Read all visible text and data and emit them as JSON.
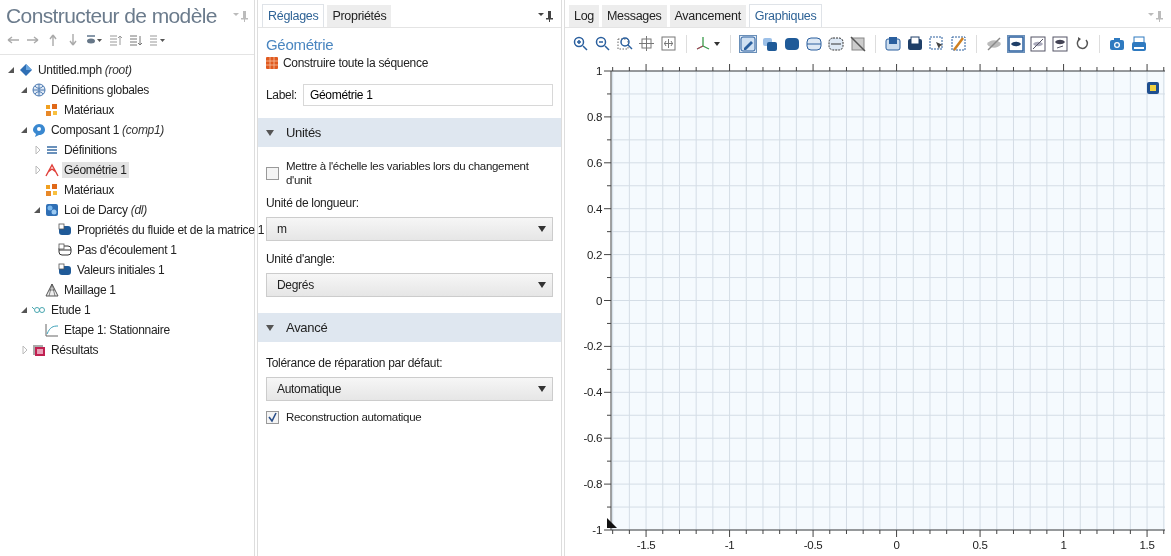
{
  "model_builder": {
    "title": "Constructeur de modèle",
    "toolbar": [
      {
        "kind": "arrow-left"
      },
      {
        "kind": "arrow-right"
      },
      {
        "kind": "arrow-up"
      },
      {
        "kind": "arrow-down"
      },
      {
        "kind": "eye-menu"
      },
      {
        "kind": "sort-up"
      },
      {
        "kind": "sort-down"
      },
      {
        "kind": "list-menu"
      }
    ],
    "tree": [
      {
        "label": "Untitled.mph",
        "suffix": "(root)",
        "kind": "model",
        "expanded": true,
        "selected": false,
        "children": [
          {
            "label": "Définitions globales",
            "kind": "globe",
            "expanded": true,
            "selected": false,
            "children": [
              {
                "label": "Matériaux",
                "kind": "materials",
                "selected": false
              }
            ]
          },
          {
            "label": "Composant 1",
            "suffix": "(comp1)",
            "kind": "component",
            "expanded": true,
            "selected": false,
            "children": [
              {
                "label": "Définitions",
                "kind": "list",
                "expanded": false,
                "selected": false
              },
              {
                "label": "Géométrie 1",
                "kind": "geometry",
                "expanded": false,
                "selected": true
              },
              {
                "label": "Matériaux",
                "kind": "materials",
                "selected": false
              },
              {
                "label": "Loi de Darcy",
                "suffix": "(dl)",
                "kind": "physics",
                "expanded": true,
                "selected": false,
                "children": [
                  {
                    "label": "Propriétés du fluide et de la matrice 1",
                    "kind": "domain",
                    "selected": false
                  },
                  {
                    "label": "Pas d'écoulement 1",
                    "kind": "boundary",
                    "selected": false
                  },
                  {
                    "label": "Valeurs initiales 1",
                    "kind": "domain",
                    "selected": false
                  }
                ]
              },
              {
                "label": "Maillage 1",
                "kind": "mesh",
                "selected": false
              }
            ]
          },
          {
            "label": "Etude 1",
            "kind": "study",
            "expanded": true,
            "selected": false,
            "children": [
              {
                "label": "Etape 1: Stationnaire",
                "kind": "step",
                "selected": false
              }
            ]
          },
          {
            "label": "Résultats",
            "kind": "results",
            "expanded": false,
            "selected": false
          }
        ]
      }
    ]
  },
  "settings": {
    "tabs": [
      {
        "label": "Réglages",
        "selected": true
      },
      {
        "label": "Propriétés",
        "selected": false
      }
    ],
    "heading": "Géométrie",
    "build_button": "Construire toute la séquence",
    "label_field": {
      "label": "Label:",
      "value": "Géométrie 1"
    },
    "sections": [
      {
        "title": "Unités",
        "expanded": true,
        "items": [
          {
            "kind": "checkbox",
            "label": "Mettre à l'échelle les variables lors du changement d'unit",
            "checked": false
          },
          {
            "kind": "select",
            "label": "Unité de longueur:",
            "value": "m"
          },
          {
            "kind": "select",
            "label": "Unité d'angle:",
            "value": "Degrés"
          }
        ]
      },
      {
        "title": "Avancé",
        "expanded": true,
        "items": [
          {
            "kind": "select",
            "label": "Tolérance de réparation par défaut:",
            "value": "Automatique"
          },
          {
            "kind": "checkbox",
            "label": "Reconstruction automatique",
            "checked": true
          }
        ]
      }
    ]
  },
  "graphics_panel": {
    "tabs": [
      {
        "label": "Log",
        "selected": false
      },
      {
        "label": "Messages",
        "selected": false
      },
      {
        "label": "Avancement",
        "selected": false
      },
      {
        "label": "Graphiques",
        "selected": true
      }
    ],
    "toolbar": [
      {
        "kind": "zoom-in",
        "selected": false
      },
      {
        "kind": "zoom-out",
        "selected": false
      },
      {
        "kind": "zoom-box",
        "selected": false
      },
      {
        "kind": "center",
        "selected": false
      },
      {
        "kind": "zoom-extents",
        "selected": false
      },
      {
        "kind": "sep"
      },
      {
        "kind": "axes",
        "selected": false
      },
      {
        "kind": "sep"
      },
      {
        "kind": "select-edit",
        "selected": true
      },
      {
        "kind": "blobs",
        "selected": false
      },
      {
        "kind": "blob",
        "selected": false
      },
      {
        "kind": "boundary",
        "selected": false
      },
      {
        "kind": "edge",
        "selected": false
      },
      {
        "kind": "no-select",
        "selected": false
      },
      {
        "kind": "sep"
      },
      {
        "kind": "box-a",
        "selected": false
      },
      {
        "kind": "box-b",
        "selected": false
      },
      {
        "kind": "box-select",
        "selected": false
      },
      {
        "kind": "box-clear",
        "selected": false
      },
      {
        "kind": "sep"
      },
      {
        "kind": "hide",
        "selected": false
      },
      {
        "kind": "view",
        "selected": true
      },
      {
        "kind": "view-hide",
        "selected": false
      },
      {
        "kind": "view-show",
        "selected": false
      },
      {
        "kind": "reset",
        "selected": false
      },
      {
        "kind": "sep"
      },
      {
        "kind": "camera",
        "selected": false
      },
      {
        "kind": "print",
        "selected": false
      }
    ],
    "x_ticks": [
      "-1.5",
      "-1",
      "-0.5",
      "0",
      "0.5",
      "1",
      "1.5"
    ],
    "y_ticks": [
      "1",
      "0.8",
      "0.6",
      "0.4",
      "0.2",
      "0",
      "-0.2",
      "-0.4",
      "-0.6",
      "-0.8",
      "-1"
    ]
  }
}
